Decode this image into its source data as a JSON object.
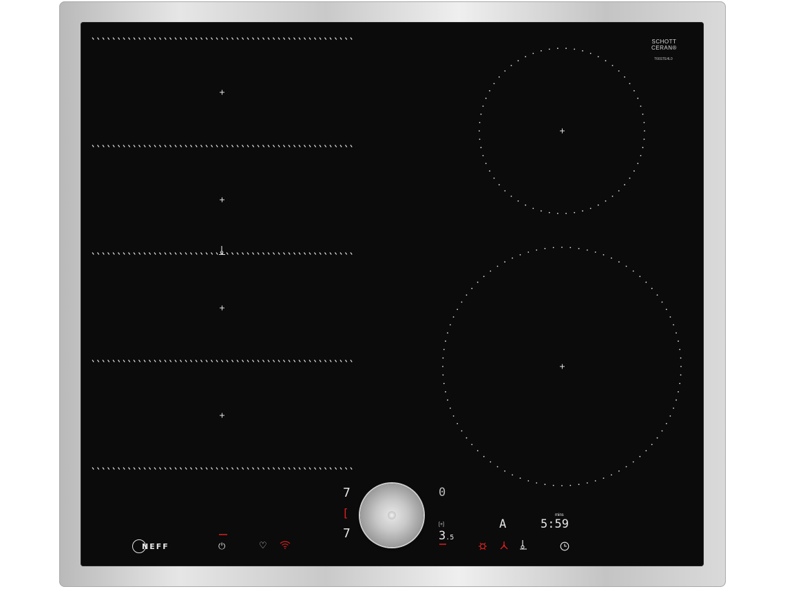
{
  "brand": {
    "logo_text": "NEFF"
  },
  "glass_mark": {
    "line1": "SCHOTT",
    "line2": "CERAN®"
  },
  "model_label": {
    "line1": "T66STE4L0",
    "line2": ""
  },
  "displays": {
    "left_top": "7",
    "left_mid": "[",
    "left_bot": "7",
    "right_top": "0",
    "right_bot": "3",
    "right_bot_sub": ".5",
    "auto": "A",
    "timer": "5:59",
    "timer_unit": "mins"
  },
  "icons": {
    "power": "power-icon",
    "favourite": "heart-icon",
    "wifi": "wifi-icon",
    "frying_sensor_small": "frying-sensor-icon",
    "child_lock": "child-lock-icon",
    "hood_fan": "hood-fan-icon",
    "frying_sensor": "frying-sensor-icon",
    "timer": "clock-icon",
    "power_boost": "power-boost-icon"
  },
  "colors": {
    "glass": "#0b0b0b",
    "marking": "#e6e6e6",
    "indicator_red": "#e02020"
  }
}
